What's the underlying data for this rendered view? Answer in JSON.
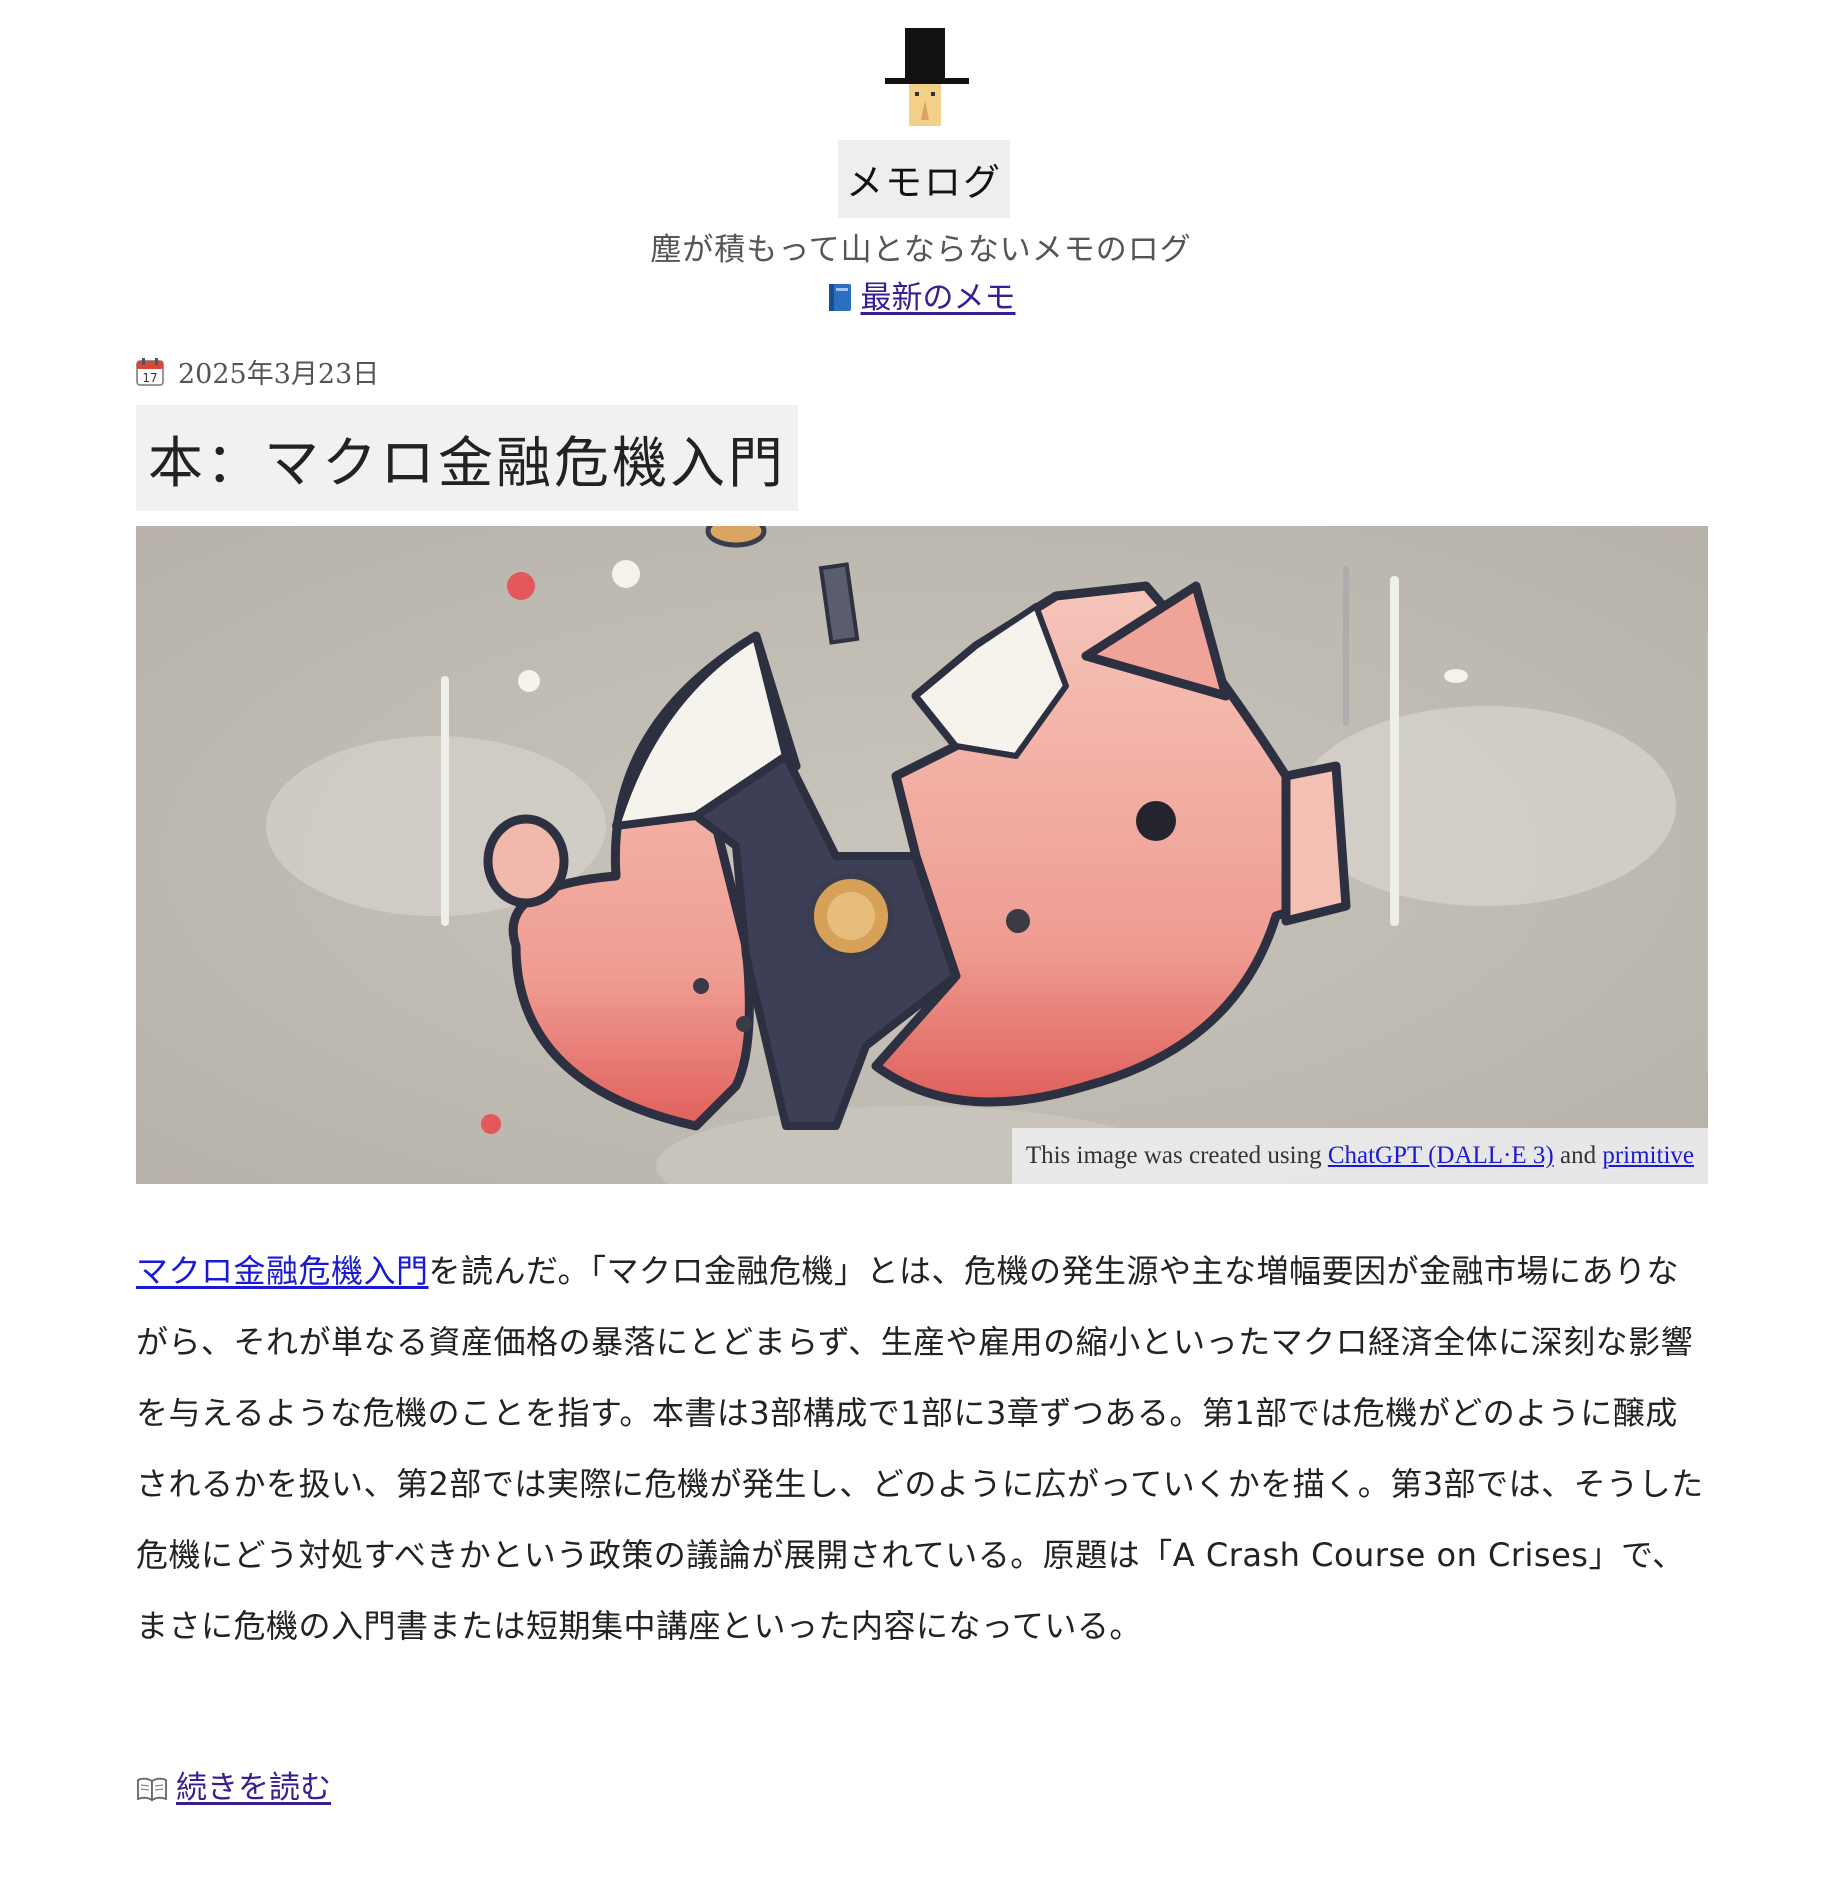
{
  "site": {
    "title": "メモログ",
    "tagline": "塵が積もって山とならないメモのログ",
    "latest_link": "最新のメモ",
    "latest_icon": "blue-book-icon"
  },
  "post": {
    "date_icon": "calendar-icon",
    "date": "2025年3月23日",
    "title": "本：マクロ金融危機入門",
    "hero_icon": "cracked-piggy-bank-illustration",
    "credit": {
      "prefix": "This image was created using",
      "link1": "ChatGPT (DALL·E 3)",
      "middle": "and",
      "link2": "primitive"
    },
    "book_link": "マクロ金融危機入門",
    "body_after_link": "を読んだ。「マクロ金融危機」とは、危機の発生源や主な増幅要因が金融市場にありながら、それが単なる資産価格の暴落にとどまらず、生産や雇用の縮小といったマクロ経済全体に深刻な影響を与えるような危機のことを指す。本書は3部構成で1部に3章ずつある。第1部では危機がどのように醸成されるかを扱い、第2部では実際に危機が発生し、どのように広がっていくかを描く。第3部では、そうした危機にどう対処すべきかという政策の議論が展開されている。原題は「A Crash Course on Crises」で、まさに危機の入門書または短期集中講座といった内容になっている。",
    "read_more": "続きを読む",
    "read_more_icon": "open-book-icon"
  },
  "colors": {
    "link": "#1a1ad6",
    "visited_link": "#3a1d8f",
    "title_bg": "#f1f1f1",
    "text": "#222222"
  }
}
